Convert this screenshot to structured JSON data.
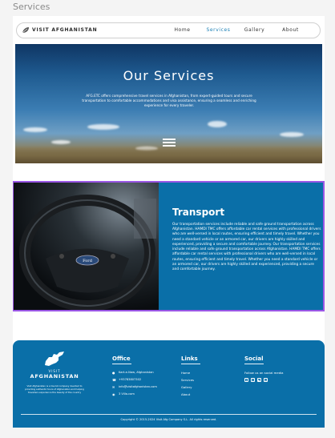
{
  "frame": {
    "title": "Services"
  },
  "nav": {
    "logo_text": "VISIT AFGHANISTAN",
    "links": [
      "Home",
      "Services",
      "Gallery",
      "About"
    ],
    "active": "Services"
  },
  "hero": {
    "title": "Our Services",
    "text": "AFG.ETC offers comprehensive travel services in Afghanistan, from expert-guided tours and secure transportation to comfortable accommodations and visa assistance, ensuring a seamless and enriching experience for every traveler."
  },
  "transport": {
    "title": "Transport",
    "text": "Our transportation services include reliable and safe ground transportation across Afghanistan. HAMDI TMC offers affordable car rental services with professional drivers who are well-versed in local routes, ensuring efficient and timely travel. Whether you need a standard vehicle or an armored car, our drivers are highly skilled and experienced, providing a secure and comfortable journey. Our transportation services include reliable and safe ground transportation across Afghanistan. HAMDI TMC offers affordable car rental services with professional drivers who are well-versed in local routes, ensuring efficient and timely travel. Whether you need a standard vehicle or an armored car, our drivers are highly skilled and experienced, providing a secure and comfortable journey."
  },
  "footer": {
    "brand_small": "VISIT",
    "brand_big": "AFGHANISTAN",
    "brand_desc": "Visit Afghanistan is a tourist company devoted to providing authentic tours of Afghanistan and helping travellers experience the beauty of the country",
    "office": {
      "title": "Office",
      "items": [
        {
          "icon": "location-icon",
          "text": "Kart-e-Naw, Afghanistan"
        },
        {
          "icon": "phone-icon",
          "text": "+93783807302"
        },
        {
          "icon": "mail-icon",
          "text": "info@visitafghanistan.com"
        },
        {
          "icon": "globe-icon",
          "text": "3 Villa.com"
        }
      ]
    },
    "links": {
      "title": "Links",
      "items": [
        "Home",
        "Services",
        "Gallery",
        "About"
      ]
    },
    "social": {
      "title": "Social",
      "subtitle": "Follow us on social media"
    },
    "copyright": "Copyright © 2015-2024 Visit Afg Company S.L. All rights reserved."
  },
  "colors": {
    "brand_blue": "#0a6fa8",
    "highlight": "#9b57e6",
    "nav_active": "#1a7fb5"
  }
}
